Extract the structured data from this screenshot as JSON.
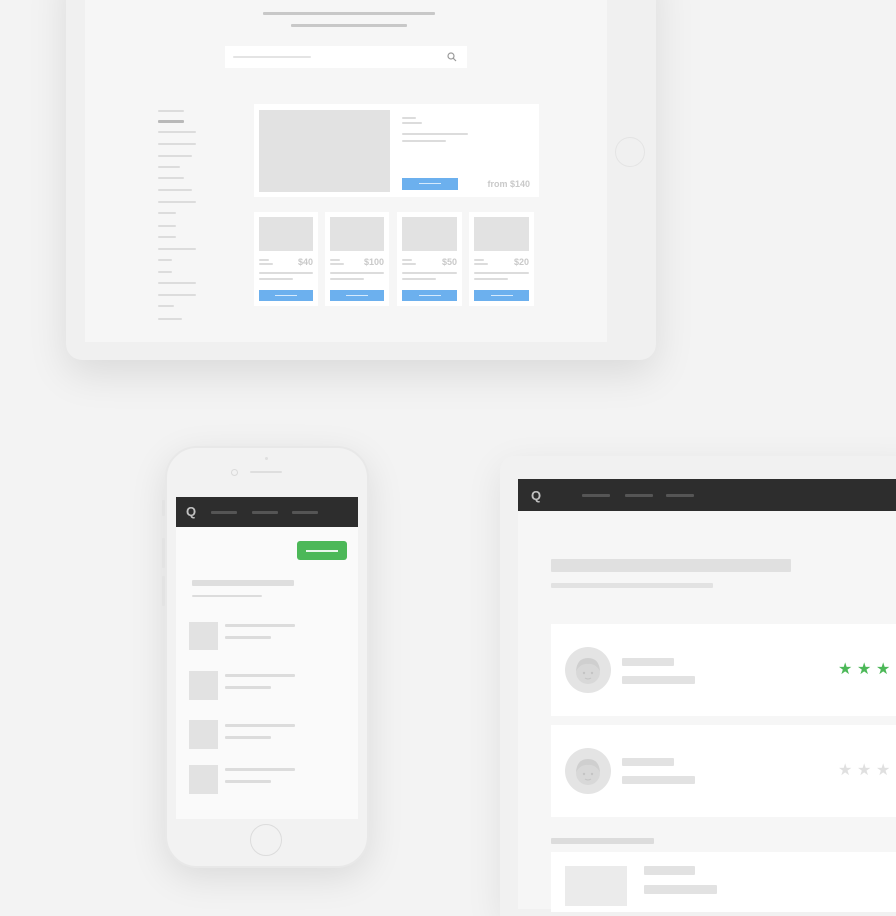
{
  "tablet": {
    "featured": {
      "price": "from $140"
    },
    "products": [
      {
        "price": "$40"
      },
      {
        "price": "$100"
      },
      {
        "price": "$50"
      },
      {
        "price": "$20"
      }
    ]
  },
  "phone": {
    "logo": "Q"
  },
  "desktop": {
    "logo": "Q",
    "reviews": [
      {
        "rating": 3,
        "star_color": "#4cb858"
      },
      {
        "rating": 0,
        "star_color": "#e0e0e0"
      }
    ]
  },
  "icons": {
    "search": "magnifier",
    "star": "★"
  },
  "colors": {
    "background": "#f3f3f3",
    "accent_blue": "#6cb0ee",
    "accent_green": "#4cb858",
    "nav_dark": "#2d2d2d"
  }
}
